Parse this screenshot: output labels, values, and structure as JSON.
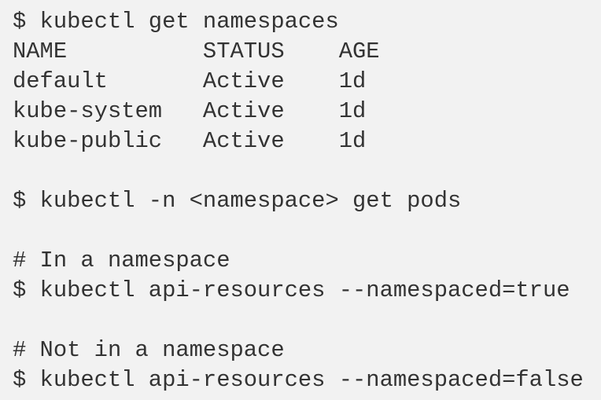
{
  "code_block": {
    "background": "#f2f2f2",
    "text_color": "#333333",
    "lines": [
      "$ kubectl get namespaces",
      "NAME          STATUS    AGE",
      "default       Active    1d",
      "kube-system   Active    1d",
      "kube-public   Active    1d",
      "",
      "$ kubectl -n <namespace> get pods",
      "",
      "# In a namespace",
      "$ kubectl api-resources --namespaced=true",
      "",
      "# Not in a namespace",
      "$ kubectl api-resources --namespaced=false"
    ]
  }
}
